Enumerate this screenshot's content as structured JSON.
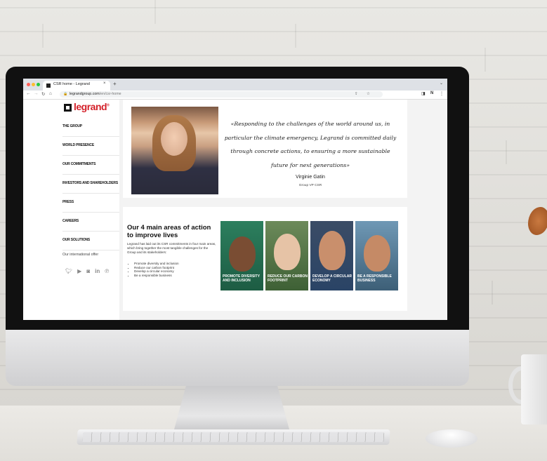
{
  "browser": {
    "tab_title": "CSR home - Legrand",
    "tab_close": "×",
    "new_tab": "+",
    "url_domain": "legrandgroup.com",
    "url_path": "/en/csr-home"
  },
  "sidebar": {
    "logo_text": "legrand",
    "logo_reg": "®",
    "items": [
      {
        "label": "THE GROUP"
      },
      {
        "label": "WORLD PRESENCE"
      },
      {
        "label": "OUR COMMITMENTS"
      },
      {
        "label": "INVESTORS AND SHAREHOLDERS"
      },
      {
        "label": "PRESS"
      },
      {
        "label": "CAREERS"
      },
      {
        "label": "OUR SOLUTIONS"
      }
    ],
    "international_offer": "Our international offer",
    "social_icons": [
      "twitter-icon",
      "youtube-icon",
      "instagram-icon",
      "linkedin-icon",
      "pinterest-icon"
    ]
  },
  "quote_card": {
    "quote": "«Responding to the challenges of the world around us, in particular the climate emergency, Legrand is committed daily through concrete actions, to ensuring a more sustainable future for next generations»",
    "name": "Virginie Gatin",
    "role": "Group VP CSR"
  },
  "areas_card": {
    "title": "Our 4 main areas of action to improve lives",
    "description": "Legrand has laid out its CSR commitments in four main areas, which bring together the most tangible challenges for the Group and its stakeholders:",
    "bullets": [
      "Promote diversity and inclusion",
      "Reduce our carbon footprint",
      "Develop a circular economy",
      "Be a responsible business"
    ],
    "tiles": [
      {
        "label": "PROMOTE DIVERSITY AND INCLUSION"
      },
      {
        "label": "REDUCE OUR CARBON FOOTPRINT"
      },
      {
        "label": "DEVELOP A CIRCULAR ECONOMY"
      },
      {
        "label": "BE A RESPONSIBLE BUSINESS"
      }
    ]
  },
  "colors": {
    "brand_red": "#d4212a",
    "traffic_red": "#ff5f57",
    "traffic_yellow": "#febc2e",
    "traffic_green": "#28c840"
  }
}
